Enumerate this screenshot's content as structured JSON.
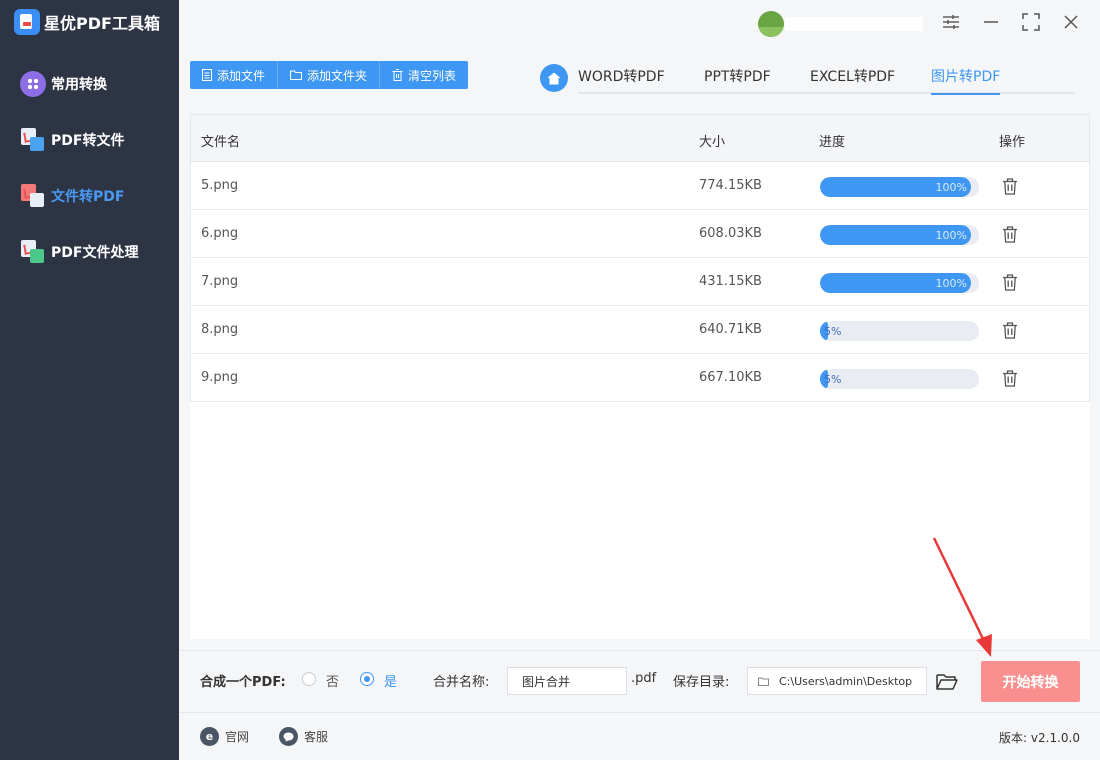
{
  "app": {
    "title": "星优PDF工具箱"
  },
  "sidebar": {
    "items": [
      {
        "label": "常用转换",
        "icon": "apps-icon"
      },
      {
        "label": "PDF转文件",
        "icon": "pdf-to-file-icon"
      },
      {
        "label": "文件转PDF",
        "icon": "file-to-pdf-icon",
        "active": true
      },
      {
        "label": "PDF文件处理",
        "icon": "pdf-process-icon"
      }
    ]
  },
  "toolbar": {
    "add_file": "添加文件",
    "add_folder": "添加文件夹",
    "clear_list": "清空列表"
  },
  "tabs": [
    {
      "label": "WORD转PDF"
    },
    {
      "label": "PPT转PDF"
    },
    {
      "label": "EXCEL转PDF"
    },
    {
      "label": "图片转PDF",
      "active": true
    }
  ],
  "table": {
    "headers": {
      "name": "文件名",
      "size": "大小",
      "progress": "进度",
      "action": "操作"
    },
    "rows": [
      {
        "name": "5.png",
        "size": "774.15KB",
        "progress": 100,
        "progress_label": "100%"
      },
      {
        "name": "6.png",
        "size": "608.03KB",
        "progress": 100,
        "progress_label": "100%"
      },
      {
        "name": "7.png",
        "size": "431.15KB",
        "progress": 100,
        "progress_label": "100%"
      },
      {
        "name": "8.png",
        "size": "640.71KB",
        "progress": 5,
        "progress_label": "5%"
      },
      {
        "name": "9.png",
        "size": "667.10KB",
        "progress": 5,
        "progress_label": "5%"
      }
    ]
  },
  "bottom": {
    "merge_label": "合成一个PDF:",
    "option_no": "否",
    "option_yes": "是",
    "selected": "是",
    "merge_name_label": "合并名称:",
    "merge_name_value": "图片合并",
    "merge_ext": ".pdf",
    "save_dir_label": "保存目录:",
    "save_dir_value": "C:\\Users\\admin\\Desktop\\",
    "start_button": "开始转换"
  },
  "footer": {
    "website": "官网",
    "support": "客服",
    "version": "版本: v2.1.0.0"
  },
  "colors": {
    "accent": "#3e97f2",
    "sidebar": "#2d3444",
    "start_button": "#f98f8f",
    "arrow": "#e8393a"
  }
}
